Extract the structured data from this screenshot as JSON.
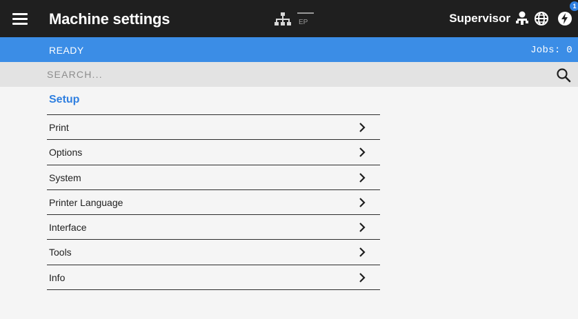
{
  "header": {
    "title": "Machine settings",
    "network_label": "EP",
    "user": "Supervisor",
    "notification_count": "1",
    "icons": [
      "menu-icon",
      "network-icon",
      "user-icon",
      "globe-icon",
      "power-icon"
    ]
  },
  "status": {
    "state": "READY",
    "jobs": "Jobs: 0",
    "color": "#3b8de6"
  },
  "search": {
    "placeholder": "SEARCH..."
  },
  "setup": {
    "title": "Setup",
    "items": [
      {
        "label": "Print"
      },
      {
        "label": "Options"
      },
      {
        "label": "System"
      },
      {
        "label": "Printer Language"
      },
      {
        "label": "Interface"
      },
      {
        "label": "Tools"
      },
      {
        "label": "Info"
      }
    ]
  },
  "colors": {
    "header_bg": "#1f1f1f",
    "accent": "#2f7fe0",
    "search_bg": "#e3e3e3",
    "page_bg": "#f5f5f5"
  }
}
